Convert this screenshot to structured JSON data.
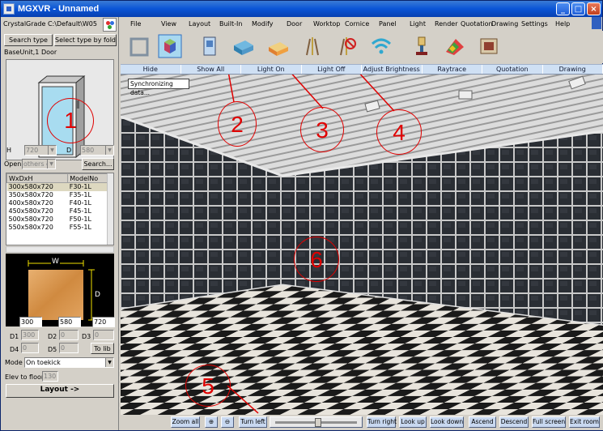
{
  "window": {
    "title": "MGXVR - Unnamed",
    "controls": [
      "_",
      "□",
      "×"
    ]
  },
  "left_panel": {
    "path": "CrystalGrade C:\\Default\\W05",
    "search_type_label": "Search type",
    "select_folder_label": "Select type by folder",
    "category": "BaseUnit,1 Door",
    "h_label": "H",
    "h_value": "720",
    "d_label": "D",
    "d_value": "580",
    "open_label": "Open",
    "open_value": "others c",
    "search_label": "Search...",
    "grid": {
      "headers": [
        "WxDxH",
        "ModelNo"
      ],
      "rows": [
        [
          "300x580x720",
          "F30-1L"
        ],
        [
          "350x580x720",
          "F35-1L"
        ],
        [
          "400x580x720",
          "F40-1L"
        ],
        [
          "450x580x720",
          "F45-1L"
        ],
        [
          "500x580x720",
          "F50-1L"
        ],
        [
          "550x580x720",
          "F55-1L"
        ]
      ]
    },
    "sketch_w": "W",
    "sketch_d": "D",
    "dims": {
      "w_label": "W",
      "w": "300",
      "d_label": "D",
      "d": "580",
      "h_label": "H",
      "h": "720"
    },
    "d1_label": "D1",
    "d1": "300",
    "d2_label": "D2",
    "d2": "0",
    "d3_label": "D3",
    "d3": "0",
    "d4_label": "D4",
    "d4": "0",
    "d5_label": "D5",
    "d5": "0",
    "to_label": "To lib",
    "mode_label": "Mode",
    "mode_value": "On toekick",
    "elev_label": "Elev to floor",
    "elev_value": "130",
    "layout_label": "Layout ->"
  },
  "menu": [
    "File",
    "View",
    "Layout",
    "Built-In",
    "Modify",
    "Door",
    "Worktop",
    "Cornice",
    "Panel",
    "Light",
    "Render",
    "Quotation",
    "Drawing",
    "Settings",
    "Help"
  ],
  "toolbar_icons": [
    "select-icon",
    "cube-icon",
    "door-icon",
    "worktop-icon",
    "cornice-icon",
    "panel-light-icon",
    "light-off-icon",
    "wireless-icon",
    "lamp-icon",
    "paint-icon",
    "film-icon"
  ],
  "tabs": [
    "Hide",
    "Show All",
    "Light On",
    "Light Off",
    "Adjust Brightness",
    "Raytrace",
    "Quotation",
    "Drawing"
  ],
  "viewport": {
    "status": "Synchronizing data..."
  },
  "bottom_buttons": {
    "zoom_all": "Zoom all",
    "turn_left": "Turn left",
    "turn_right": "Turn right",
    "look_up": "Look up",
    "look_down": "Look down",
    "ascend": "Ascend",
    "descend": "Descend",
    "full_screen": "Full screen",
    "exit_room": "Exit room"
  },
  "annotations": [
    "1",
    "2",
    "3",
    "4",
    "5",
    "6"
  ],
  "colors": {
    "title_bar": "#0a54d6",
    "annotation": "#e00000",
    "tab_bar": "#cfe0f4"
  }
}
